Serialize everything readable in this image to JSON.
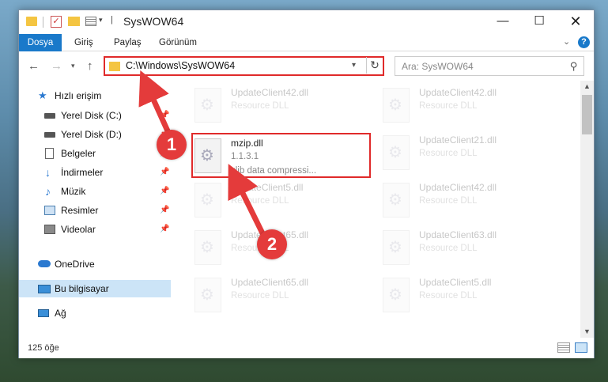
{
  "window": {
    "title": "SysWOW64",
    "min": "—",
    "max": "☐",
    "close": "✕"
  },
  "ribbon": {
    "tabs": [
      "Dosya",
      "Giriş",
      "Paylaş",
      "Görünüm"
    ],
    "help": "?"
  },
  "nav": {
    "back": "←",
    "forward": "→",
    "dropdown": "▾",
    "up": "↑",
    "address": "C:\\Windows\\SysWOW64",
    "address_drop": "▾",
    "refresh": "↻",
    "search_placeholder": "Ara: SysWOW64",
    "search_icon": "⚲"
  },
  "sidebar": {
    "items": [
      {
        "label": "Hızlı erişim",
        "icon": "star-icon"
      },
      {
        "label": "Yerel Disk (C:)",
        "icon": "drive-icon"
      },
      {
        "label": "Yerel Disk (D:)",
        "icon": "drive-icon"
      },
      {
        "label": "Belgeler",
        "icon": "document-icon"
      },
      {
        "label": "İndirmeler",
        "icon": "download-icon"
      },
      {
        "label": "Müzik",
        "icon": "music-icon"
      },
      {
        "label": "Resimler",
        "icon": "pictures-icon"
      },
      {
        "label": "Videolar",
        "icon": "video-icon"
      },
      {
        "label": "OneDrive",
        "icon": "cloud-icon"
      },
      {
        "label": "Bu bilgisayar",
        "icon": "computer-icon"
      },
      {
        "label": "Ağ",
        "icon": "network-icon"
      }
    ],
    "pin": "📌"
  },
  "files": {
    "left": [
      {
        "name": "UpdateClient42.dll",
        "desc": "Resource DLL"
      },
      {
        "name": "UpdateClient5.dll",
        "desc": "Resource DLL"
      },
      {
        "name": "UpdateClient65.dll",
        "desc": "Resource DLL"
      },
      {
        "name": "UpdateClient65.dll",
        "desc": "Resource DLL"
      }
    ],
    "right": [
      {
        "name": "UpdateClient42.dll",
        "desc": "Resource DLL"
      },
      {
        "name": "UpdateClient21.dll",
        "desc": "Resource DLL"
      },
      {
        "name": "UpdateClient42.dll",
        "desc": "Resource DLL"
      },
      {
        "name": "UpdateClient63.dll",
        "desc": "Resource DLL"
      },
      {
        "name": "UpdateClient5.dll",
        "desc": "Resource DLL"
      }
    ],
    "highlighted": {
      "name": "mzip.dll",
      "version": "1.1.3.1",
      "desc": "zlib data compressi..."
    }
  },
  "status": {
    "count": "125 öğe"
  },
  "annotations": {
    "marker1": "1",
    "marker2": "2",
    "color": "#e43b3b"
  }
}
